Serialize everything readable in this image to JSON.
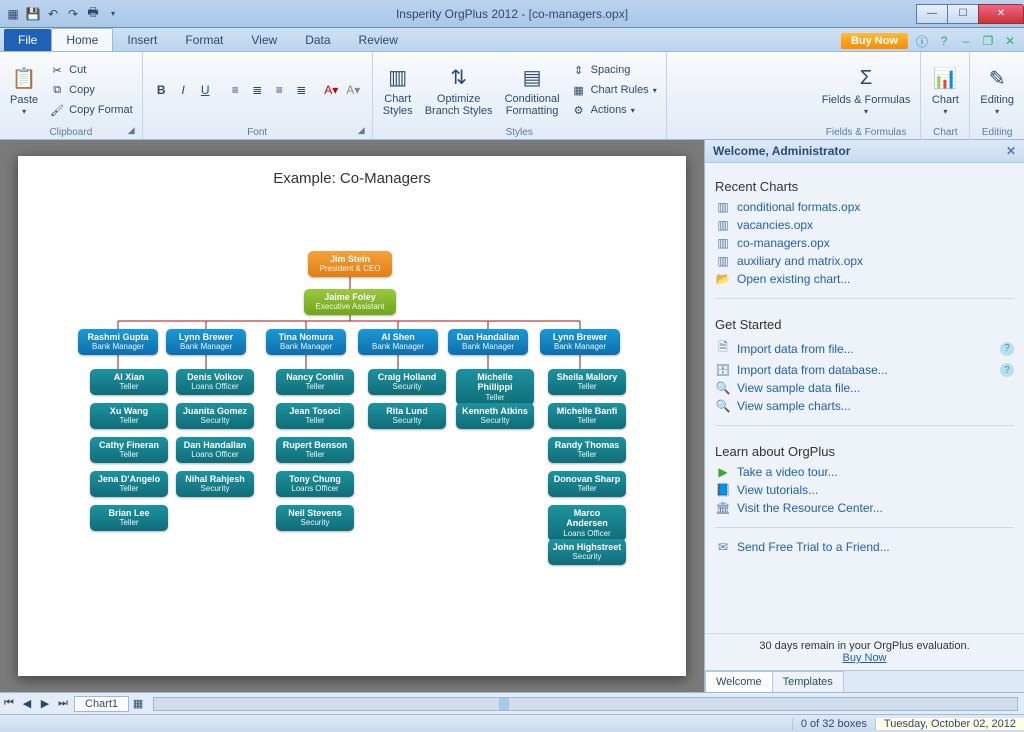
{
  "window": {
    "title": "Insperity OrgPlus 2012 - [co-managers.opx]"
  },
  "ribbon": {
    "file": "File",
    "tabs": [
      "Home",
      "Insert",
      "Format",
      "View",
      "Data",
      "Review"
    ],
    "buynow": "Buy Now"
  },
  "groups": {
    "clipboard": {
      "label": "Clipboard",
      "paste": "Paste",
      "cut": "Cut",
      "copy": "Copy",
      "copyfmt": "Copy Format"
    },
    "font": {
      "label": "Font"
    },
    "styles": {
      "label": "Styles",
      "chartstyles": "Chart\nStyles",
      "optimize": "Optimize\nBranch Styles",
      "cond": "Conditional\nFormatting",
      "spacing": "Spacing",
      "chartrules": "Chart Rules",
      "actions": "Actions"
    },
    "fields": {
      "label": "Fields & Formulas",
      "btn": "Fields & Formulas"
    },
    "chartg": {
      "label": "Chart",
      "btn": "Chart"
    },
    "editing": {
      "label": "Editing",
      "btn": "Editing"
    }
  },
  "chart_title": "Example: Co-Managers",
  "sheet": "Chart1",
  "status": {
    "boxes": "0 of 32 boxes",
    "date": "Tuesday, October 02, 2012"
  },
  "panel": {
    "welcome": "Welcome, Administrator",
    "recentHdr": "Recent Charts",
    "recent": [
      "conditional formats.opx",
      "vacancies.opx",
      "co-managers.opx",
      "auxiliary and matrix.opx"
    ],
    "openExisting": "Open existing chart...",
    "getStartedHdr": "Get Started",
    "importFile": "Import data from file...",
    "importDb": "Import data from database...",
    "viewData": "View sample data file...",
    "viewCharts": "View sample charts...",
    "learnHdr": "Learn about OrgPlus",
    "tour": "Take a video tour...",
    "tutorials": "View tutorials...",
    "resource": "Visit the Resource Center...",
    "sendTrial": "Send Free Trial to a Friend...",
    "trialMsg": "30 days remain in your OrgPlus evaluation.",
    "trialLink": "Buy Now",
    "tabWelcome": "Welcome",
    "tabTemplates": "Templates"
  },
  "chart_data": {
    "type": "tree",
    "ceo": {
      "name": "Jim Stein",
      "title": "President & CEO"
    },
    "ea": {
      "name": "Jaime Foley",
      "title": "Executive Assistant"
    },
    "managers": [
      {
        "name": "Rashmi Gupta",
        "title": "Bank Manager"
      },
      {
        "name": "Lynn Brewer",
        "title": "Bank Manager"
      },
      {
        "name": "Tina Nomura",
        "title": "Bank Manager"
      },
      {
        "name": "Al Shen",
        "title": "Bank Manager"
      },
      {
        "name": "Dan Handallan",
        "title": "Bank Manager"
      },
      {
        "name": "Lynn Brewer",
        "title": "Bank Manager"
      }
    ],
    "cols": [
      [
        {
          "name": "Al Xian",
          "title": "Teller"
        },
        {
          "name": "Xu Wang",
          "title": "Teller"
        },
        {
          "name": "Cathy Fineran",
          "title": "Teller"
        },
        {
          "name": "Jena D'Angelo",
          "title": "Teller"
        },
        {
          "name": "Brian Lee",
          "title": "Teller"
        }
      ],
      [
        {
          "name": "Denis Volkov",
          "title": "Loans Officer"
        },
        {
          "name": "Juanita Gomez",
          "title": "Security"
        },
        {
          "name": "Dan Handallan",
          "title": "Loans Officer"
        },
        {
          "name": "Nihal Rahjesh",
          "title": "Security"
        }
      ],
      [
        {
          "name": "Nancy Conlin",
          "title": "Teller"
        },
        {
          "name": "Jean Tosoci",
          "title": "Teller"
        },
        {
          "name": "Rupert Benson",
          "title": "Teller"
        },
        {
          "name": "Tony Chung",
          "title": "Loans Officer"
        },
        {
          "name": "Neil Stevens",
          "title": "Security"
        }
      ],
      [
        {
          "name": "Craig Holland",
          "title": "Security"
        },
        {
          "name": "Rita Lund",
          "title": "Security"
        }
      ],
      [
        {
          "name": "Michelle Phillippi",
          "title": "Teller"
        },
        {
          "name": "Kenneth Atkins",
          "title": "Security"
        }
      ],
      [
        {
          "name": "Sheila Mallory",
          "title": "Teller"
        },
        {
          "name": "Michelle Banfi",
          "title": "Teller"
        },
        {
          "name": "Randy Thomas",
          "title": "Teller"
        },
        {
          "name": "Donovan Sharp",
          "title": "Teller"
        },
        {
          "name": "Marco Andersen",
          "title": "Loans Officer"
        },
        {
          "name": "John Highstreet",
          "title": "Security"
        }
      ]
    ]
  }
}
